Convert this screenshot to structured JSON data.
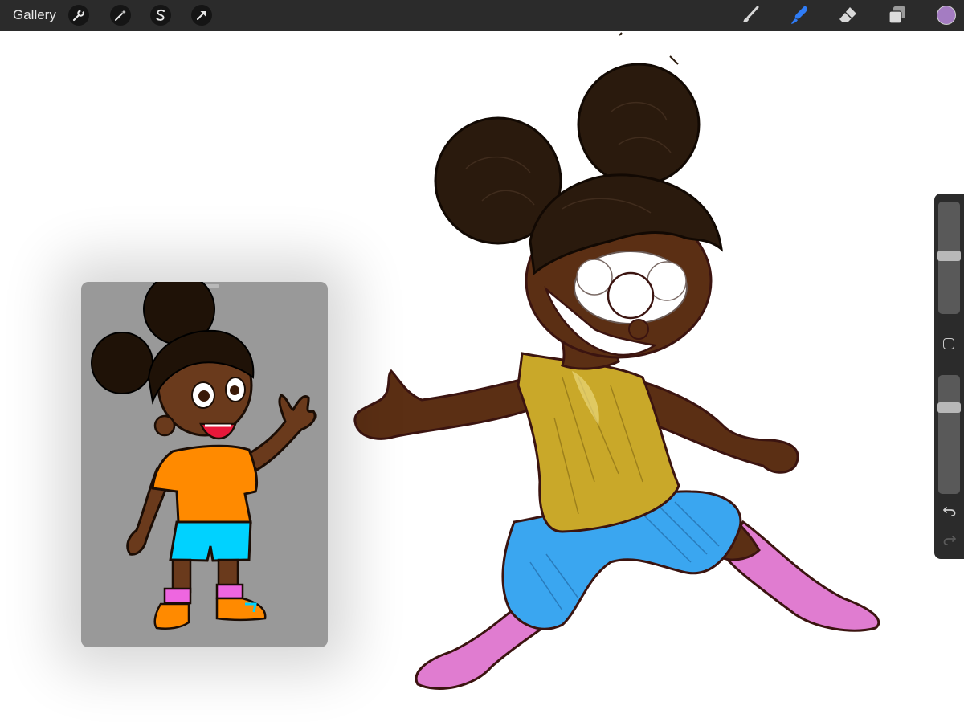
{
  "topbar": {
    "gallery_label": "Gallery",
    "left_tools": [
      "wrench-icon",
      "magic-wand-icon",
      "selection-s-icon",
      "transform-arrow-icon"
    ],
    "right_tools": [
      "brush-icon",
      "smudge-icon",
      "eraser-icon",
      "layers-icon"
    ],
    "active_tool": "smudge-icon",
    "current_color": "#a47cc2"
  },
  "sidebar": {
    "brush_size_level": 0.52,
    "brush_opacity_level": 0.75,
    "buttons": [
      "modify-square-icon",
      "undo-icon",
      "redo-icon"
    ]
  },
  "reference_window": {
    "background": "#999999"
  },
  "colors": {
    "active_tool": "#2f7cf6",
    "skin": "#5b2f14",
    "hair": "#2a1a0d",
    "shirt_sketch": "#c9a829",
    "shorts_sketch": "#3aa6f0",
    "socks_sketch": "#e07cd0",
    "ref_shirt": "#ff8a00",
    "ref_shorts": "#00d2ff"
  }
}
